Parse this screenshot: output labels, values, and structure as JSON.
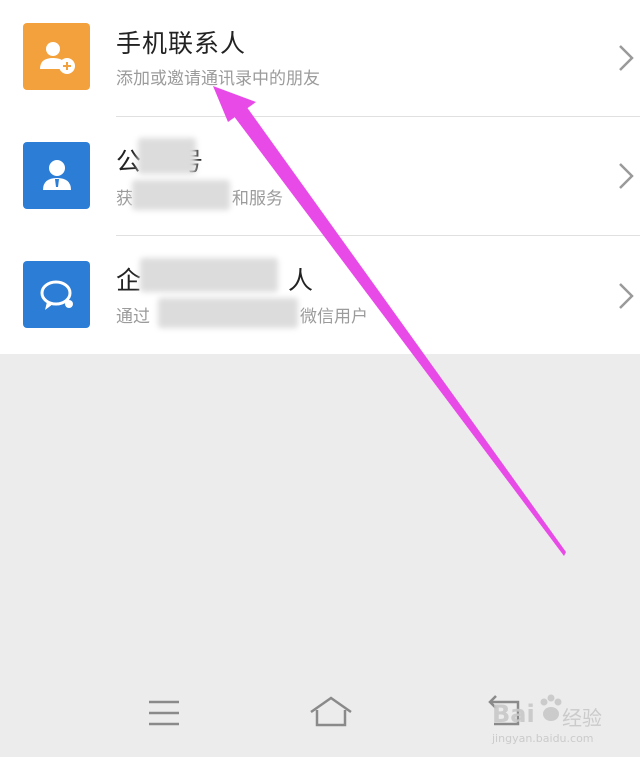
{
  "list": {
    "items": [
      {
        "title": "手机联系人",
        "subtitle": "添加或邀请通讯录中的朋友",
        "icon": "add-contact-icon",
        "color": "#f3a13c"
      },
      {
        "title": "",
        "subtitle": "和服务",
        "icon": "person-icon",
        "color": "#2b7dd6"
      },
      {
        "title": "人",
        "subtitle": "微信用户",
        "icon": "chat-bubble-icon",
        "color": "#2b7dd6"
      }
    ]
  },
  "row2": {
    "title_prefix": "公",
    "title_suffix": "号",
    "sub_prefix": "获"
  },
  "row3": {
    "title_prefix": "企",
    "sub_prefix": "通过"
  },
  "navbar": {
    "menu_icon": "menu-icon",
    "home_icon": "home-icon",
    "back_icon": "back-icon"
  },
  "watermark": {
    "text": "Bai",
    "cn": "经验",
    "sub": "jingyan.baidu.com"
  },
  "annotation": {
    "color": "#e84ae8"
  }
}
